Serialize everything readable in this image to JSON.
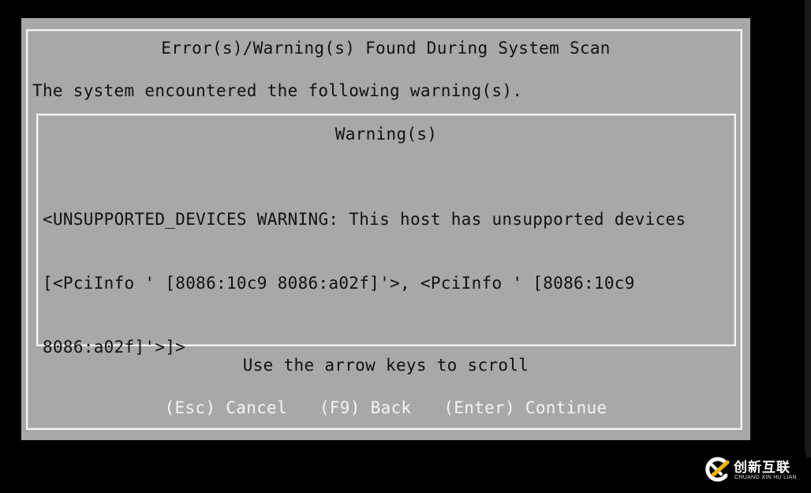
{
  "dialog": {
    "title": "Error(s)/Warning(s) Found During System Scan",
    "subtitle": "The system encountered the following warning(s).",
    "warnings_box": {
      "title": "Warning(s)",
      "lines": [
        "<UNSUPPORTED_DEVICES WARNING: This host has unsupported devices",
        "[<PciInfo ' [8086:10c9 8086:a02f]'>, <PciInfo ' [8086:10c9",
        "8086:a02f]'>]>"
      ]
    },
    "scroll_hint": "Use the arrow keys to scroll",
    "actions": [
      {
        "key": "(Esc)",
        "label": "Cancel"
      },
      {
        "key": "(F9)",
        "label": "Back"
      },
      {
        "key": "(Enter)",
        "label": "Continue"
      }
    ]
  },
  "watermark": {
    "name_cn": "创新互联",
    "name_en": "CHUANG XIN HU LIAN",
    "icon": "logo-icon",
    "accent_color": "#f0b400"
  },
  "colors": {
    "background": "#000000",
    "dialog": "#a8a8a8",
    "border": "#f2f2f2",
    "text": "#111111",
    "action_text": "#f4f4f4"
  }
}
